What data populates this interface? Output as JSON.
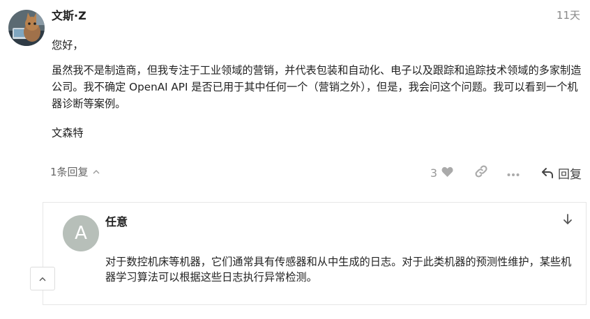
{
  "post": {
    "author": "文斯·Z",
    "date": "11天",
    "paragraphs": [
      "您好，",
      "虽然我不是制造商，但我专注于工业领域的营销，并代表包装和自动化、电子以及跟踪和追踪技术领域的多家制造公司。我不确定 OpenAI API 是否已用于其中任何一个（营销之外），但是，我会问这个问题。我可以看到一个机器诊断等案例。",
      "文森特"
    ],
    "replies_label": "1条回复",
    "like_count": "3",
    "reply_label": "回复"
  },
  "embedded_reply": {
    "avatar_letter": "A",
    "avatar_color": "#b7bfb9",
    "author": "任意",
    "body": "对于数控机床等机器，它们通常具有传感器和从中生成的日志。对于此类机器的预测性维护，某些机器学习算法可以根据这些日志执行异常检测。"
  },
  "icons": [
    "chevron-up-icon",
    "heart-icon",
    "link-icon",
    "ellipsis-icon",
    "reply-arrow-icon",
    "arrow-down-icon"
  ]
}
